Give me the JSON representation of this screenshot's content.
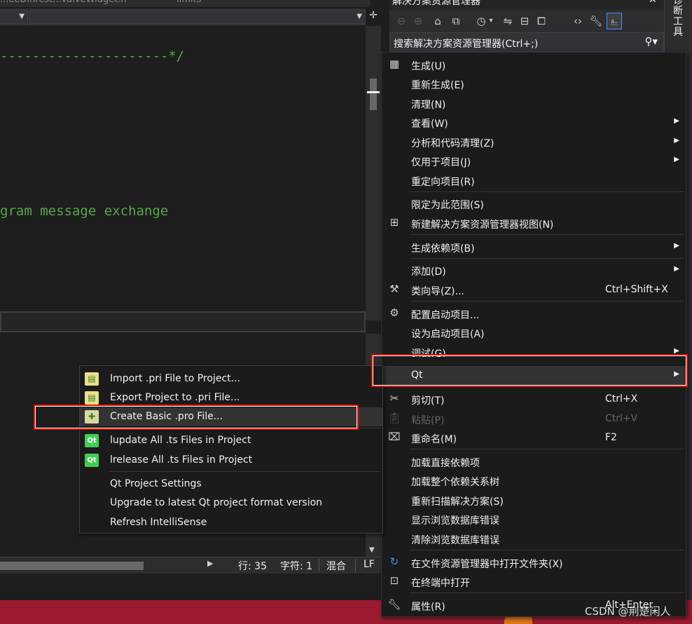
{
  "editor": {
    "tabs": [
      "...eeDihrest...valveWidget.h",
      "limits"
    ],
    "code_line_1": "---------------------*/",
    "code_line_2": "gram message exchange"
  },
  "status_bar": {
    "line": "行: 35",
    "char": "字符: 1",
    "mixed": "混合",
    "eol": "LF"
  },
  "solution_explorer": {
    "title": "解决方案资源管理器",
    "search_placeholder": "搜索解决方案资源管理器(Ctrl+;)"
  },
  "right_strip": {
    "label": "诊断工具"
  },
  "context_menu": {
    "items": [
      {
        "label": "生成(U)",
        "icon": "build-icon"
      },
      {
        "label": "重新生成(E)"
      },
      {
        "label": "清理(N)"
      },
      {
        "label": "查看(W)",
        "submenu": true
      },
      {
        "label": "分析和代码清理(Z)",
        "submenu": true
      },
      {
        "label": "仅用于项目(J)",
        "submenu": true
      },
      {
        "label": "重定向项目(R)"
      },
      {
        "label": "限定为此范围(S)"
      },
      {
        "label": "新建解决方案资源管理器视图(N)",
        "icon": "new-view-icon"
      },
      {
        "label": "生成依赖项(B)",
        "submenu": true
      },
      {
        "label": "添加(D)",
        "submenu": true
      },
      {
        "label": "类向导(Z)...",
        "shortcut": "Ctrl+Shift+X",
        "icon": "class-wizard-icon"
      },
      {
        "label": "配置启动项目...",
        "icon": "gear-icon"
      },
      {
        "label": "设为启动项目(A)"
      },
      {
        "label": "调试(G)",
        "submenu": true
      },
      {
        "label": "Qt",
        "submenu": true
      },
      {
        "label": "剪切(T)",
        "shortcut": "Ctrl+X",
        "icon": "scissors-icon"
      },
      {
        "label": "粘贴(P)",
        "shortcut": "Ctrl+V",
        "icon": "paste-icon",
        "disabled": true
      },
      {
        "label": "重命名(M)",
        "shortcut": "F2",
        "icon": "rename-icon"
      },
      {
        "label": "加载直接依赖项"
      },
      {
        "label": "加载整个依赖关系树"
      },
      {
        "label": "重新扫描解决方案(S)"
      },
      {
        "label": "显示浏览数据库错误"
      },
      {
        "label": "清除浏览数据库错误"
      },
      {
        "label": "在文件资源管理器中打开文件夹(X)",
        "icon": "refresh-folder-icon"
      },
      {
        "label": "在终端中打开",
        "icon": "terminal-icon"
      },
      {
        "label": "属性(R)",
        "shortcut": "Alt+Enter",
        "icon": "wrench-icon"
      }
    ]
  },
  "qt_submenu": {
    "items": [
      {
        "label": "Import .pri File to Project...",
        "icon": "import-pri-icon"
      },
      {
        "label": "Export Project to .pri File...",
        "icon": "export-pri-icon"
      },
      {
        "label": "Create Basic .pro File...",
        "icon": "create-pro-icon"
      },
      {
        "label": "lupdate All .ts Files in Project",
        "icon": "qt-icon"
      },
      {
        "label": "lrelease All .ts Files in Project",
        "icon": "qt-icon"
      },
      {
        "label": "Qt Project Settings"
      },
      {
        "label": "Upgrade to latest Qt project format version"
      },
      {
        "label": "Refresh IntelliSense"
      }
    ]
  },
  "watermark": "CSDN @荆楚闲人",
  "colors": {
    "highlight_border": "#e51400",
    "menu_bg": "#1b1b1c",
    "code_comment": "#57a64a",
    "taskbar": "#9b1b30"
  }
}
